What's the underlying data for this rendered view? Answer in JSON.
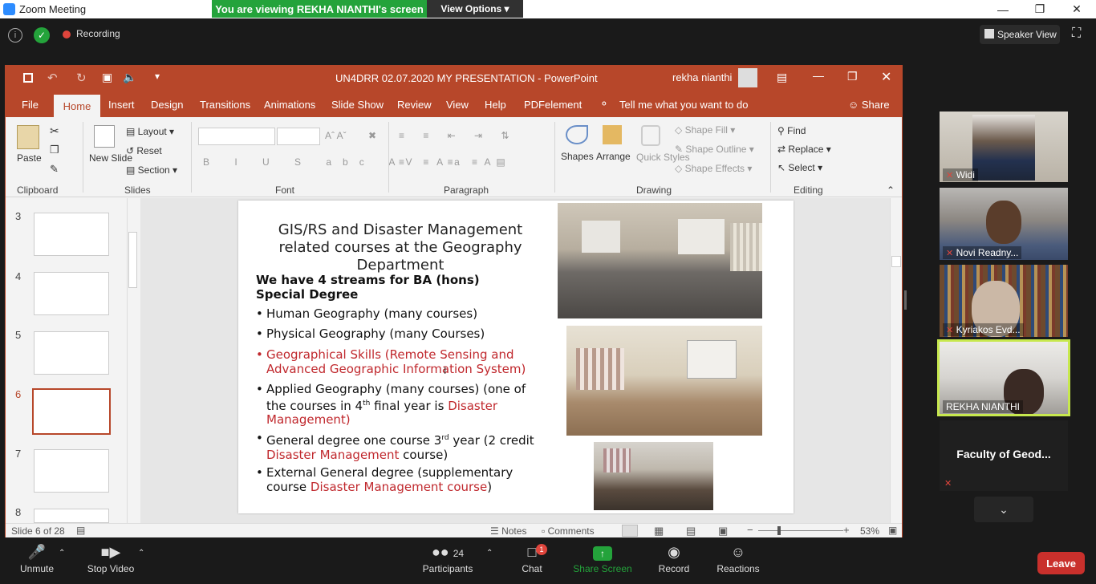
{
  "zoom": {
    "window_title": "Zoom Meeting",
    "banner": "You are viewing REKHA NIANTHI's screen",
    "view_options": "View Options",
    "recording": "Recording",
    "speaker_view": "Speaker View"
  },
  "ppt": {
    "title": "UN4DRR 02.07.2020 MY PRESENTATION  -  PowerPoint",
    "user": "rekha nianthi",
    "tabs": [
      "File",
      "Home",
      "Insert",
      "Design",
      "Transitions",
      "Animations",
      "Slide Show",
      "Review",
      "View",
      "Help",
      "PDFelement"
    ],
    "tell_me": "Tell me what you want to do",
    "share": "Share",
    "ribbon": {
      "paste": "Paste",
      "clipboard": "Clipboard",
      "new_slide": "New Slide",
      "layout": "Layout",
      "reset": "Reset",
      "section": "Section",
      "slides": "Slides",
      "font": "Font",
      "paragraph": "Paragraph",
      "shapes": "Shapes",
      "arrange": "Arrange",
      "quick_styles": "Quick Styles",
      "shape_fill": "Shape Fill",
      "shape_outline": "Shape Outline",
      "shape_effects": "Shape Effects",
      "drawing": "Drawing",
      "find": "Find",
      "replace": "Replace",
      "select": "Select",
      "editing": "Editing"
    },
    "thumbs": [
      "3",
      "4",
      "5",
      "6",
      "7",
      "8"
    ],
    "status": {
      "slide": "Slide 6 of 28",
      "notes": "Notes",
      "comments": "Comments",
      "zoom": "53%"
    },
    "slide": {
      "title": "GIS/RS and Disaster Management related courses at the Geography Department",
      "streams": "We have 4 streams for BA (hons) Special Degree",
      "b1": "Human Geography (many courses)",
      "b2": "Physical Geography (many Courses)",
      "b3": "Geographical Skills (Remote Sensing and Advanced Geographic Information System)",
      "b4a": "Applied Geography (many courses)  (one of the courses in 4",
      "b4sup": "th",
      "b4b": " final year is ",
      "b4red": "Disaster Management)",
      "b5a": "General degree one course 3",
      "b5sup": "rd",
      "b5b": " year (2 credit ",
      "b5red": "Disaster Management",
      "b5c": " course)",
      "b6a": "External General degree (supplementary course ",
      "b6red": "Disaster Management course",
      "b6c": ")"
    }
  },
  "participants": [
    {
      "name": "Widi"
    },
    {
      "name": "Novi Readny..."
    },
    {
      "name": "Kyriakos Evd..."
    },
    {
      "name": "REKHA NIANTHI"
    },
    {
      "name": "Faculty of Geod..."
    }
  ],
  "toolbar": {
    "unmute": "Unmute",
    "stop_video": "Stop Video",
    "participants": "Participants",
    "participants_count": "24",
    "chat": "Chat",
    "chat_badge": "1",
    "share_screen": "Share Screen",
    "record": "Record",
    "reactions": "Reactions",
    "leave": "Leave"
  },
  "colors": {
    "ppt_accent": "#b7472a",
    "share_green": "#24a33b",
    "leave_red": "#c9302c"
  }
}
